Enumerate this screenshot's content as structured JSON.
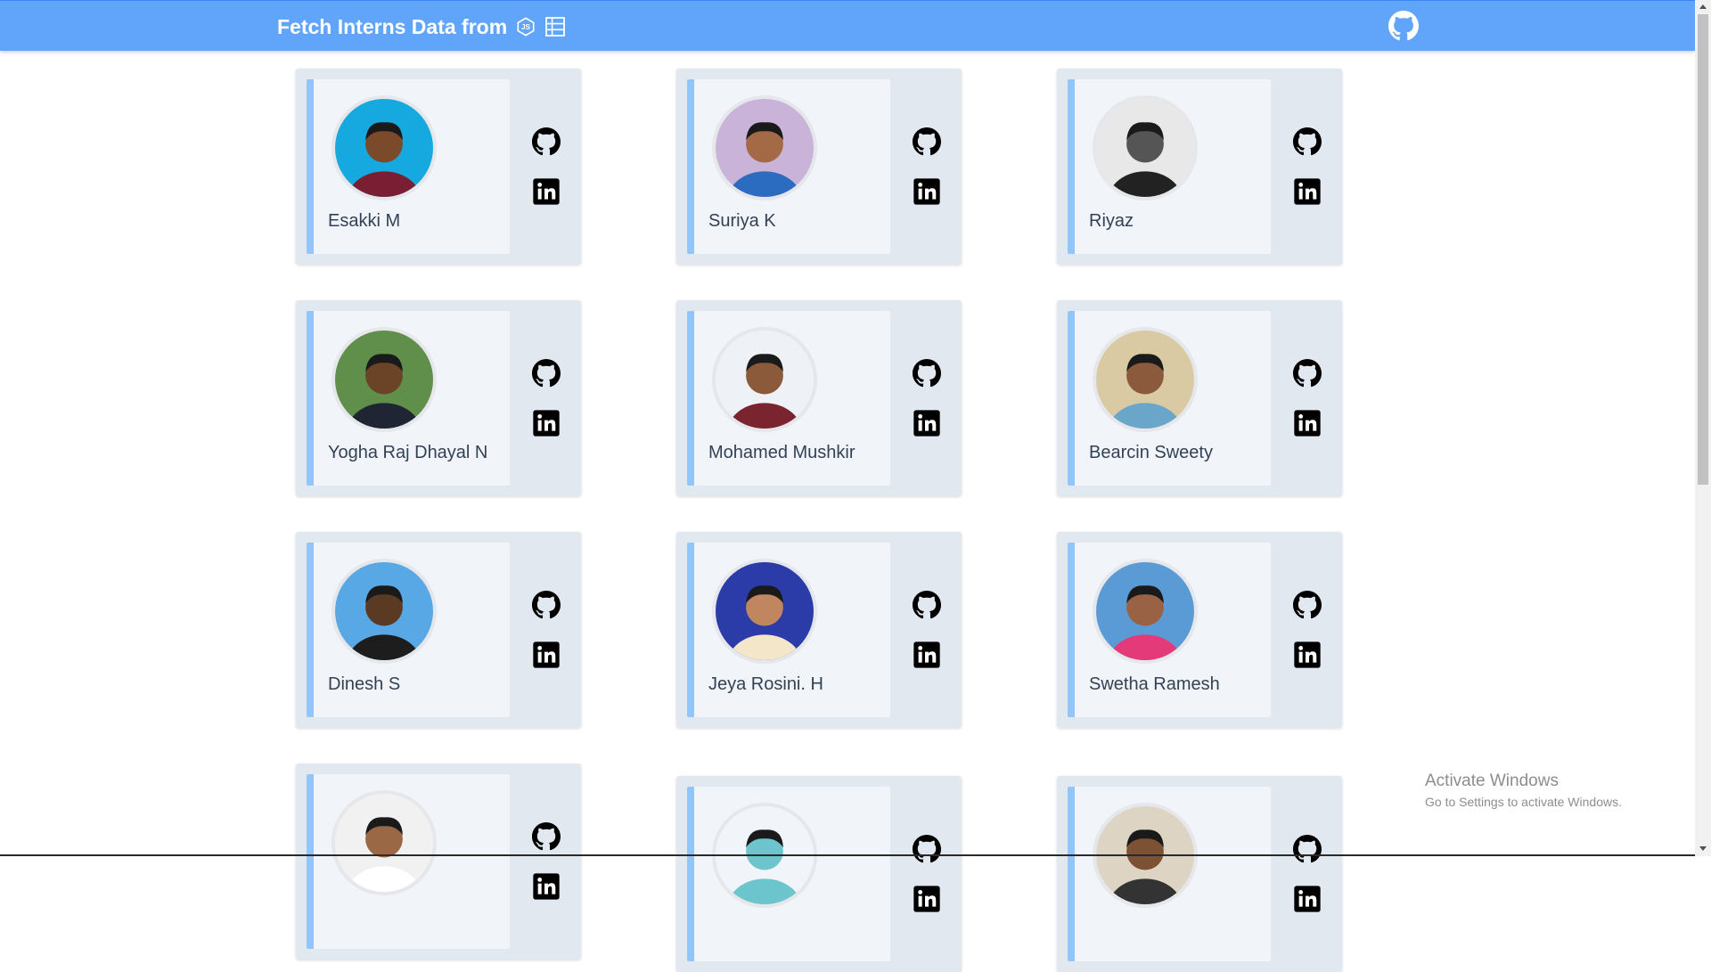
{
  "header": {
    "title": "Fetch Interns Data from",
    "icons": [
      "javascript-icon",
      "database-icon"
    ],
    "github_icon": "github-icon"
  },
  "colors": {
    "header": "#60a5fa",
    "card": "#e2e8f0",
    "card_inner": "#f1f5f9",
    "accent": "#93c5fd"
  },
  "interns": [
    {
      "name": "Esakki M"
    },
    {
      "name": "Suriya K"
    },
    {
      "name": "Riyaz"
    },
    {
      "name": "Yogha Raj Dhayal N"
    },
    {
      "name": "Mohamed Mushkir"
    },
    {
      "name": "Bearcin Sweety"
    },
    {
      "name": "Dinesh S"
    },
    {
      "name": "Jeya Rosini. H"
    },
    {
      "name": "Swetha Ramesh"
    },
    {
      "name": ""
    },
    {
      "name": ""
    },
    {
      "name": ""
    }
  ],
  "card_icons": [
    "github-icon",
    "linkedin-icon"
  ],
  "watermark": {
    "title": "Activate Windows",
    "subtitle": "Go to Settings to activate Windows."
  }
}
